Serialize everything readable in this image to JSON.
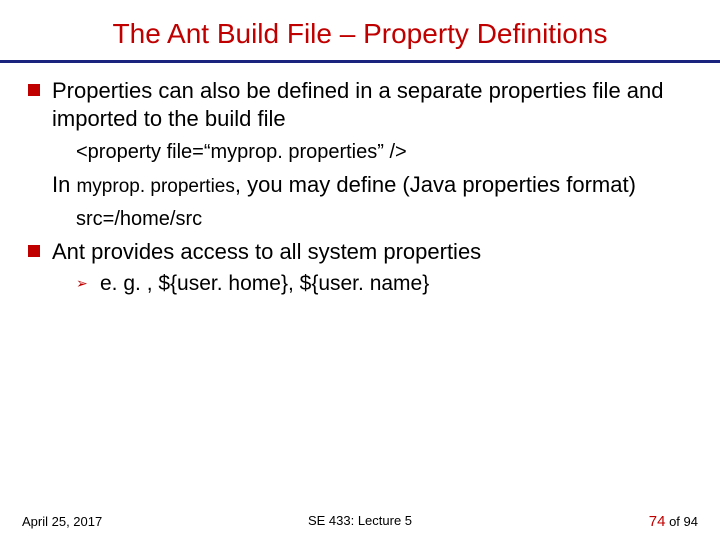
{
  "title": "The Ant Build File – Property Definitions",
  "bullets": {
    "b1": "Properties can also be defined in a separate properties file and imported to the build file",
    "b1_code": "<property file=“myprop. properties” />",
    "b1_line2a": "In ",
    "b1_line2_mono": "myprop. properties",
    "b1_line2b": ", you may define (Java properties format)",
    "b1_code2": "src=/home/src",
    "b2": "Ant provides access to all system properties",
    "b2_sub": "e. g. , ${user. home}, ${user. name}"
  },
  "footer": {
    "date": "April 25, 2017",
    "course": "SE 433: Lecture 5",
    "page_cur": "74",
    "page_of": " of 94"
  }
}
